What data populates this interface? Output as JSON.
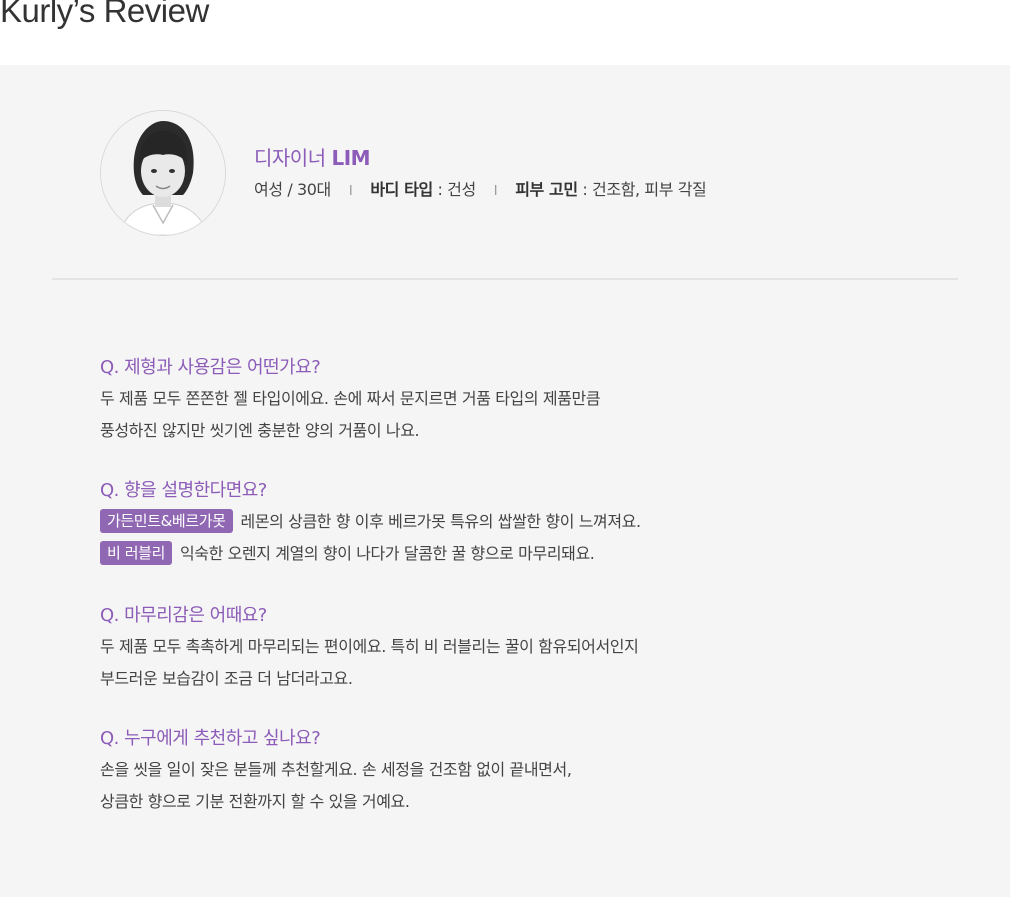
{
  "page": {
    "title": "Kurly’s Review"
  },
  "profile": {
    "name_prefix": "디자이너",
    "name": "LIM",
    "gender_age": "여성 / 30대",
    "separator": "I",
    "body_type_label": "바디 타입",
    "body_type_value": " : 건성",
    "skin_concern_label": "피부 고민",
    "skin_concern_value": " : 건조함, 피부 각질"
  },
  "qa": [
    {
      "question": "Q. 제형과 사용감은 어떤가요?",
      "answer_lines": [
        "두 제품 모두 쫀쫀한 젤 타입이에요. 손에 짜서 문지르면 거품 타입의 제품만큼",
        "풍성하진 않지만 씻기엔 충분한 양의 거품이 나요."
      ]
    },
    {
      "question": "Q. 향을 설명한다면요?",
      "tagged_lines": [
        {
          "tag": "가든민트&베르가못",
          "text": "레몬의 상큼한 향 이후 베르가못 특유의 쌉쌀한 향이 느껴져요."
        },
        {
          "tag": "비 러블리",
          "text": "익숙한 오렌지 계열의 향이 나다가 달콤한 꿀 향으로 마무리돼요."
        }
      ]
    },
    {
      "question": "Q. 마무리감은 어때요?",
      "answer_lines": [
        "두 제품 모두 촉촉하게 마무리되는 편이에요. 특히 비 러블리는 꿀이 함유되어서인지",
        "부드러운 보습감이 조금 더 남더라고요."
      ]
    },
    {
      "question": "Q. 누구에게 추천하고 싶나요?",
      "answer_lines": [
        "손을 씻을 일이 잦은 분들께 추천할게요. 손 세정을 건조함 없이 끝내면서,",
        "상큼한 향으로 기분 전환까지 할 수 있을 거예요."
      ]
    }
  ],
  "colors": {
    "accent": "#8c5cb8",
    "tag_bg": "#9067b3",
    "panel_bg": "#f5f5f5"
  }
}
